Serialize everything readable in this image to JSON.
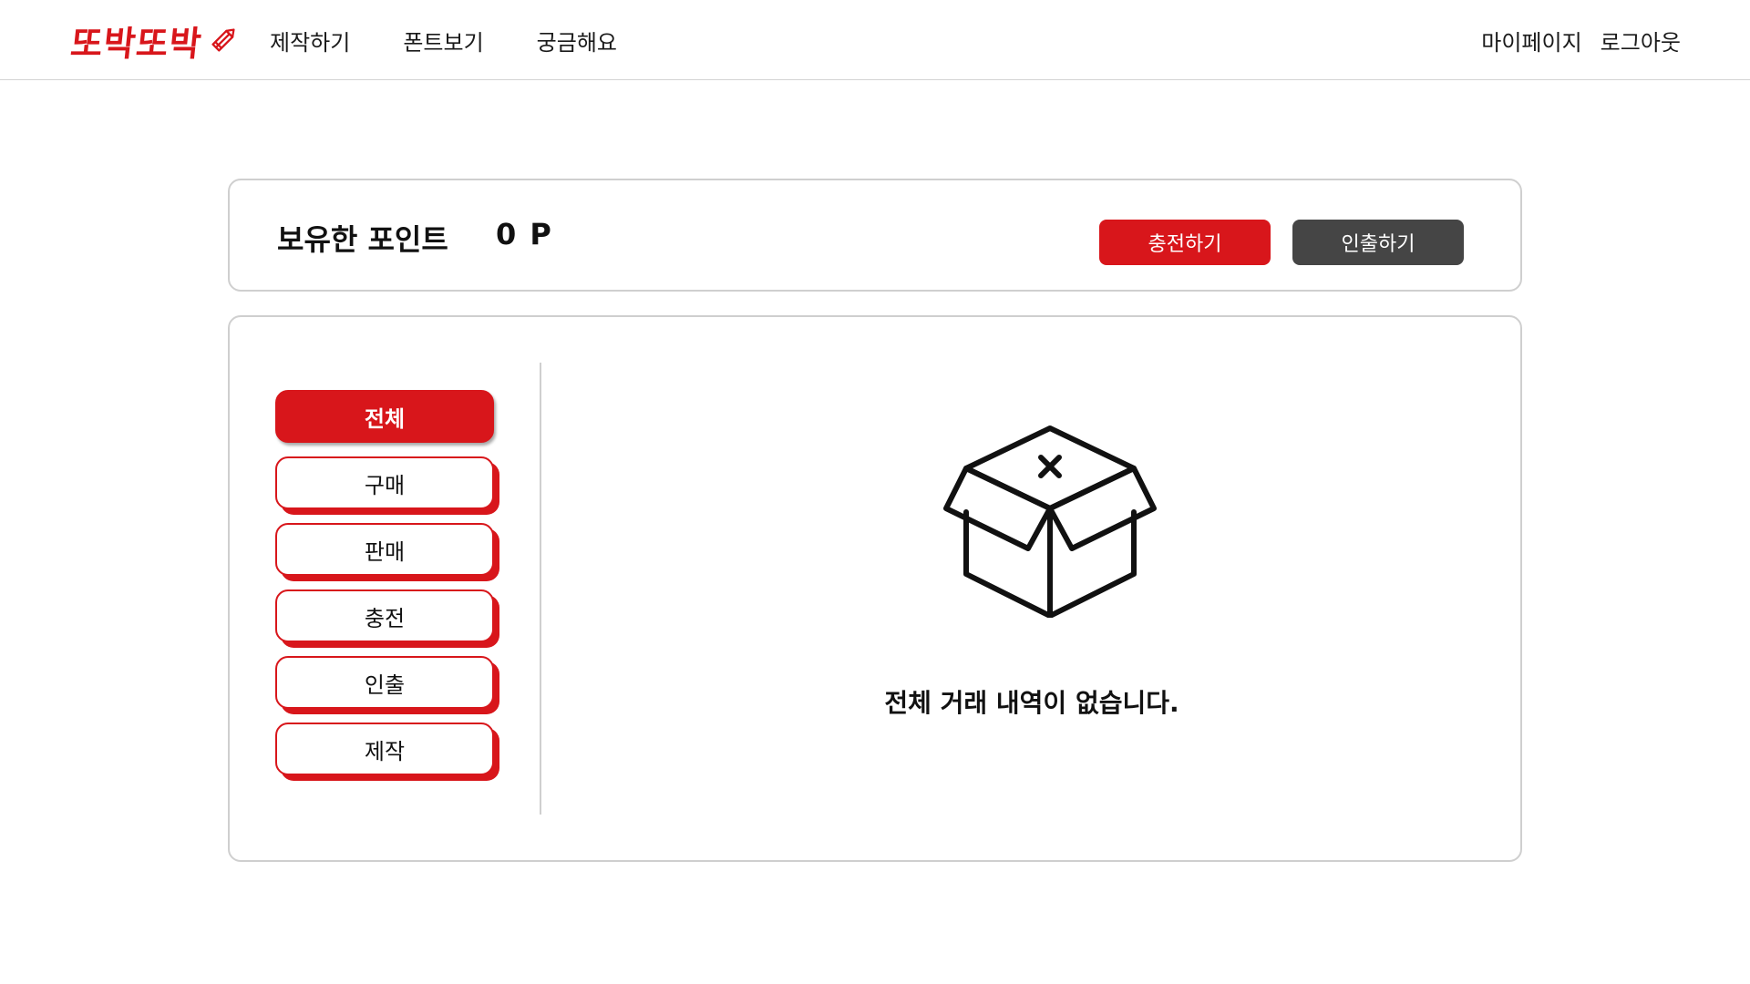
{
  "header": {
    "logo_text": "또박또박",
    "nav": [
      {
        "label": "제작하기"
      },
      {
        "label": "폰트보기"
      },
      {
        "label": "궁금해요"
      }
    ],
    "user_nav": {
      "mypage": "마이페이지",
      "logout": "로그아웃"
    }
  },
  "points": {
    "label": "보유한 포인트",
    "value": "0 P",
    "charge_button": "충전하기",
    "withdraw_button": "인출하기"
  },
  "history": {
    "filters": [
      {
        "label": "전체",
        "active": true
      },
      {
        "label": "구매",
        "active": false
      },
      {
        "label": "판매",
        "active": false
      },
      {
        "label": "충전",
        "active": false
      },
      {
        "label": "인출",
        "active": false
      },
      {
        "label": "제작",
        "active": false
      }
    ],
    "empty_icon": "empty-box-icon",
    "empty_message": "전체 거래 내역이 없습니다."
  },
  "colors": {
    "brand": "#d8161b",
    "dark_button": "#454545",
    "border": "#cfcfcf"
  }
}
